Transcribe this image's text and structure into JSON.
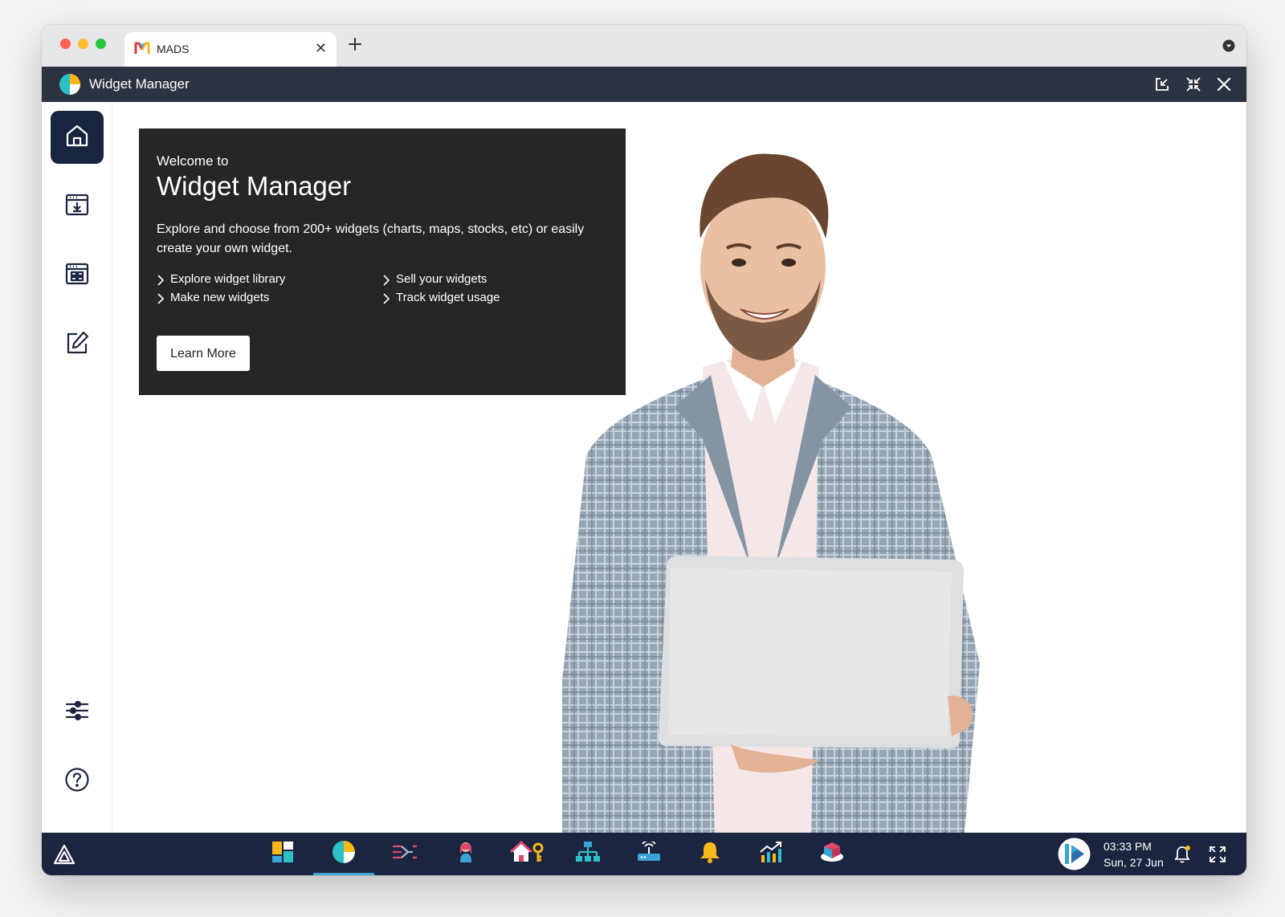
{
  "browser": {
    "tab_title": "MADS",
    "tab_close_glyph": "✕",
    "icons": [
      "mads-logo-icon",
      "close-icon",
      "plus-icon",
      "chevron-down-icon"
    ]
  },
  "titlebar": {
    "title": "Widget Manager",
    "icons": [
      "widget-manager-logo-icon",
      "popout-icon",
      "collapse-icon",
      "close-icon"
    ]
  },
  "sidebar": {
    "items": [
      {
        "name": "home",
        "icon": "home-icon",
        "active": true
      },
      {
        "name": "install",
        "icon": "download-window-icon",
        "active": false
      },
      {
        "name": "library",
        "icon": "grid-window-icon",
        "active": false
      },
      {
        "name": "edit",
        "icon": "edit-icon",
        "active": false
      }
    ],
    "bottom": [
      {
        "name": "settings",
        "icon": "sliders-icon"
      },
      {
        "name": "help",
        "icon": "help-icon"
      }
    ]
  },
  "welcome": {
    "subtitle": "Welcome to",
    "title": "Widget Manager",
    "description": "Explore and choose from 200+ widgets (charts, maps, stocks, etc) or easily create your own widget.",
    "features": [
      "Explore widget library",
      "Make new widgets",
      "Sell your widgets",
      "Track widget usage"
    ],
    "button_label": "Learn More"
  },
  "taskbar": {
    "apps": [
      "dashboard-icon",
      "widget-manager-icon",
      "data-flow-icon",
      "user-icon",
      "property-keys-icon",
      "network-topology-icon",
      "router-icon",
      "notification-bell-icon",
      "growth-chart-icon",
      "cube-layers-icon"
    ],
    "active_app": "widget-manager-icon",
    "time": "03:33 PM",
    "date": "Sun, 27 Jun"
  },
  "colors": {
    "titlebar": "#2c3340",
    "taskbar": "#1b2540",
    "sidebar_active": "#19243f",
    "card": "#262626",
    "accent": "#3aa3d8"
  }
}
